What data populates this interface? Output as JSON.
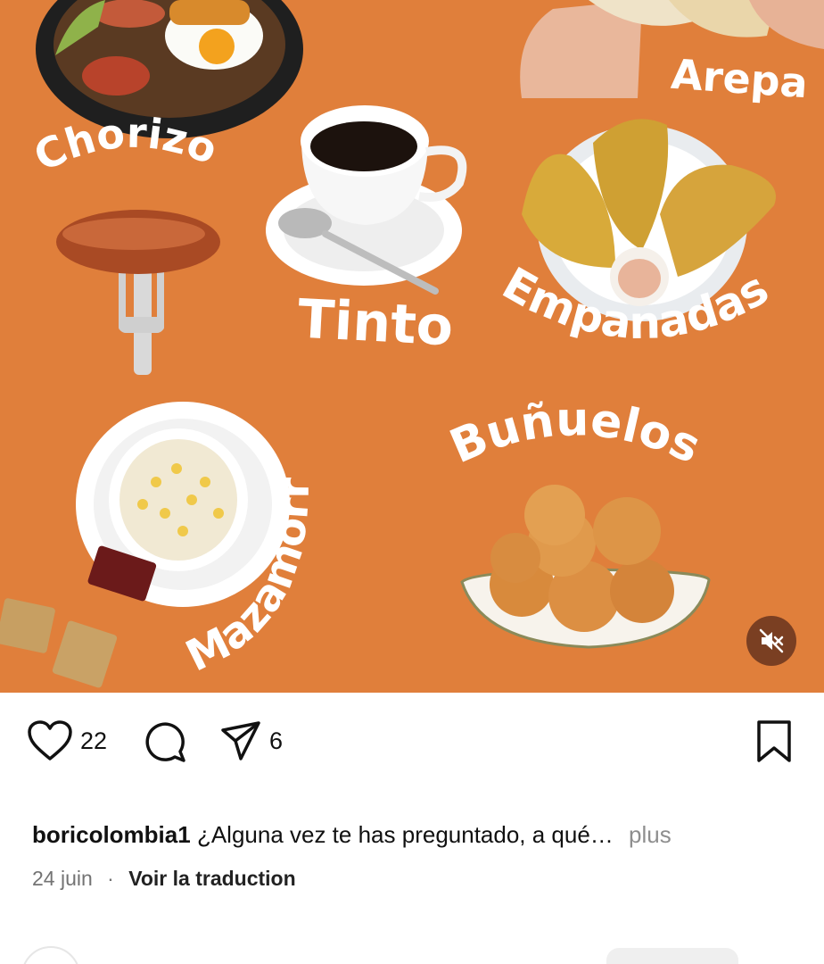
{
  "post": {
    "food_labels": {
      "chorizo": "Chorizo",
      "arepa": "Arepa",
      "tinto": "Tinto",
      "empanadas": "Empanadas",
      "bunuelos": "Buñuelos",
      "mazamorra": "Mazamorra"
    },
    "colors": {
      "background": "#e07f3b",
      "label_text": "#ffffff",
      "mute_button": "#7a3f22"
    }
  },
  "actions": {
    "like_count": "22",
    "share_count": "6",
    "icons": {
      "like": "heart-icon",
      "comment": "comment-bubble-icon",
      "share": "paper-plane-icon",
      "save": "bookmark-icon",
      "mute": "speaker-muted-icon"
    }
  },
  "caption": {
    "username": "boricolombia1",
    "text": "¿Alguna vez te has preguntado, a qué…",
    "more_label": "plus",
    "date": "24 juin",
    "separator": "·",
    "translate_label": "Voir la traduction"
  }
}
